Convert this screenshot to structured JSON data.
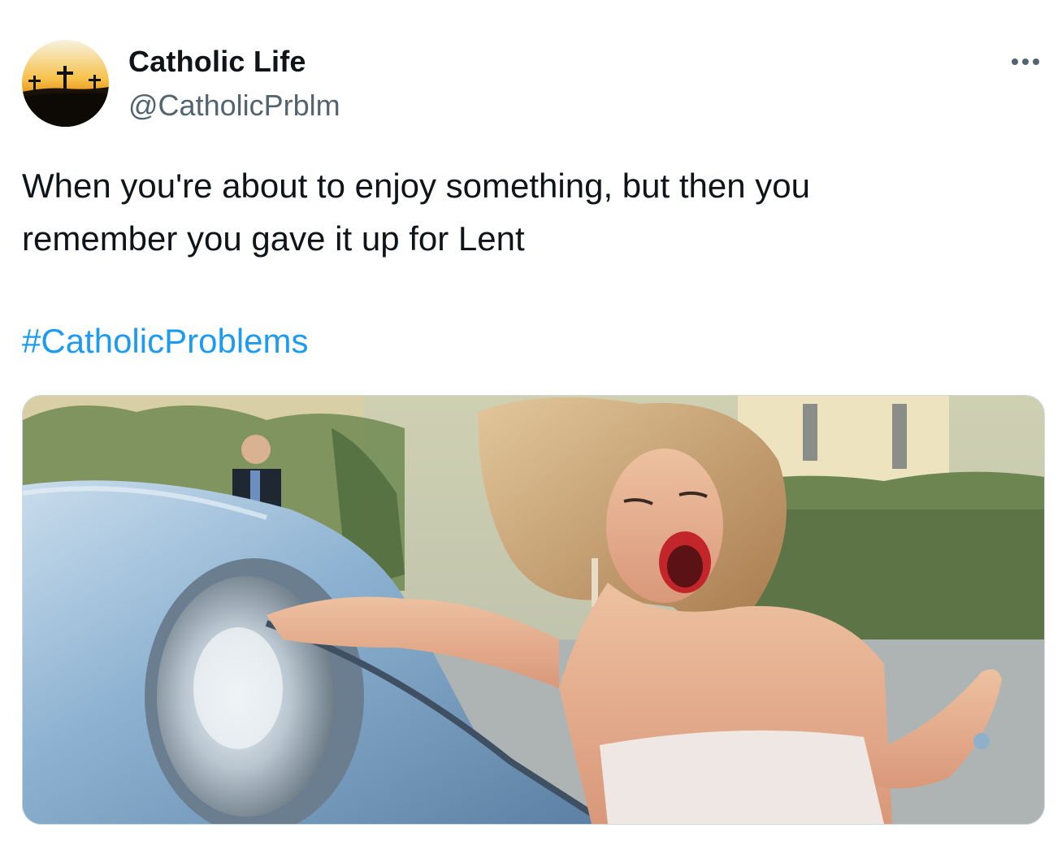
{
  "tweet": {
    "author": {
      "display_name": "Catholic Life",
      "handle": "@CatholicPrblm",
      "avatar_icon": "three-crosses-sunset-avatar"
    },
    "more_icon": "more-options-icon",
    "text_lines": [
      "When you're about to enjoy something, but then you",
      "remember you gave it up for Lent"
    ],
    "hashtag": "#CatholicProblems",
    "media": {
      "kind": "photo"
    }
  },
  "colors": {
    "text": "#0f1419",
    "secondary_text": "#536471",
    "link": "#1d9bf0",
    "border": "#cfd9de"
  }
}
